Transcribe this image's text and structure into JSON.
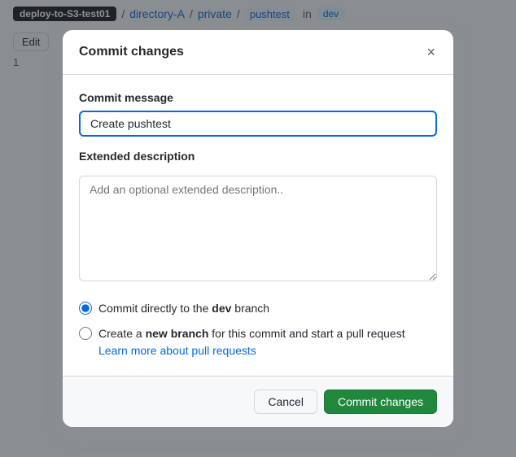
{
  "topbar": {
    "brand": "deploy-to-S3-test01",
    "sep1": "/",
    "dir1": "directory-A",
    "sep2": "/",
    "dir2": "private",
    "sep3": "/",
    "file": "pushtest",
    "in_label": "in",
    "branch_badge": "dev"
  },
  "subbar": {
    "edit_label": "Edit",
    "line_number": "1"
  },
  "modal": {
    "title": "Commit changes",
    "close_icon": "×",
    "commit_message_label": "Commit message",
    "commit_message_value": "Create pushtest",
    "extended_desc_label": "Extended description",
    "extended_desc_placeholder": "Add an optional extended description..",
    "radio_option1_label": "Commit directly to the ",
    "radio_option1_branch": "dev",
    "radio_option1_suffix": " branch",
    "radio_option2_prefix": "Create a ",
    "radio_option2_bold": "new branch",
    "radio_option2_suffix": " for this commit and start a pull request ",
    "radio_option2_link": "Learn more about pull requests",
    "cancel_label": "Cancel",
    "commit_label": "Commit changes"
  }
}
